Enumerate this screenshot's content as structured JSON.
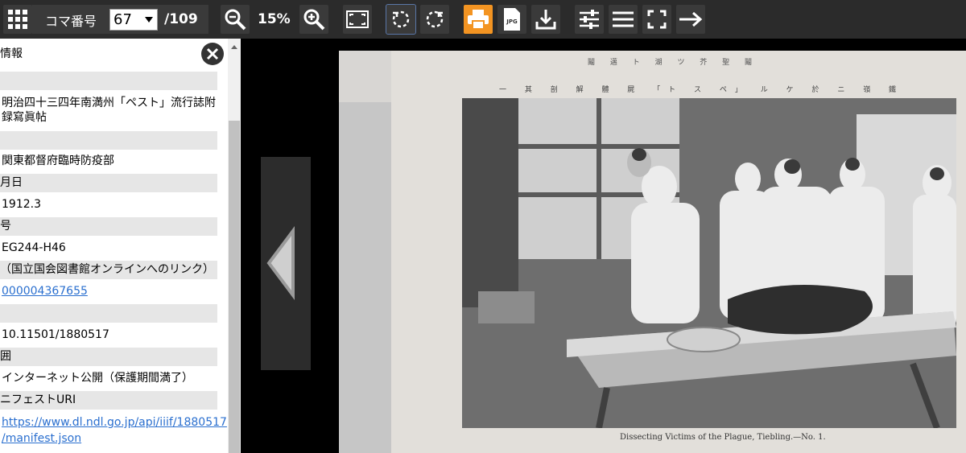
{
  "toolbar": {
    "grid_icon": "grid-icon",
    "koma_label": "コマ番号",
    "koma_value": "67",
    "koma_total": "/109",
    "zoom_out_icon": "zoom-out-icon",
    "zoom_pct": "15%",
    "zoom_in_icon": "zoom-in-icon",
    "fit_icon": "fit-screen-icon",
    "rotate_left_icon": "rotate-left-icon",
    "rotate_right_icon": "rotate-right-icon",
    "print_icon": "print-icon",
    "jpg_icon": "jpg-icon",
    "jpg_text": "JPG",
    "download_icon": "download-icon",
    "settings_icon": "settings-sliders-icon",
    "menu_icon": "menu-icon",
    "fullscreen_icon": "fullscreen-icon",
    "arrow_icon": "arrow-right-icon",
    "accent_orange": "#f39422"
  },
  "sidebar": {
    "section_title": "情報",
    "rows": [
      {
        "label": "",
        "value": "明治四十三四年南満州「ペスト」流行誌附録寫眞帖"
      },
      {
        "label": "",
        "value": "関東都督府臨時防疫部"
      },
      {
        "label": "月日",
        "value": "1912.3"
      },
      {
        "label": "号",
        "value": "EG244-H46"
      },
      {
        "label": "（国立国会図書館オンラインへのリンク）",
        "value": "000004367655"
      },
      {
        "label": "",
        "value": "10.11501/1880517"
      },
      {
        "label": "囲",
        "value": "インターネット公開（保護期間満了）"
      },
      {
        "label": "ニフェストURI",
        "value": "https://www.dl.ndl.go.jp/api/iiif/1880517/manifest.json"
      }
    ],
    "row_value_line1": "明治四十三四年南満州「ペスト」流行誌附",
    "row_value_line2": "録寫眞帖",
    "uri_line1": "https://www.dl.ndl.go.jp/api/iiif/1880517",
    "uri_line2": "/manifest.json"
  },
  "page": {
    "header_top": "鬮 邁 ト 湖 ツ 芥 聖 鬮",
    "header_jp": "一 其 剖 解 體 屍 「ト ス ペ」 ル ケ 於 ニ 嶺 鐵",
    "caption": "Dissecting Victims of the Plague, Tiebling.—No. 1."
  }
}
